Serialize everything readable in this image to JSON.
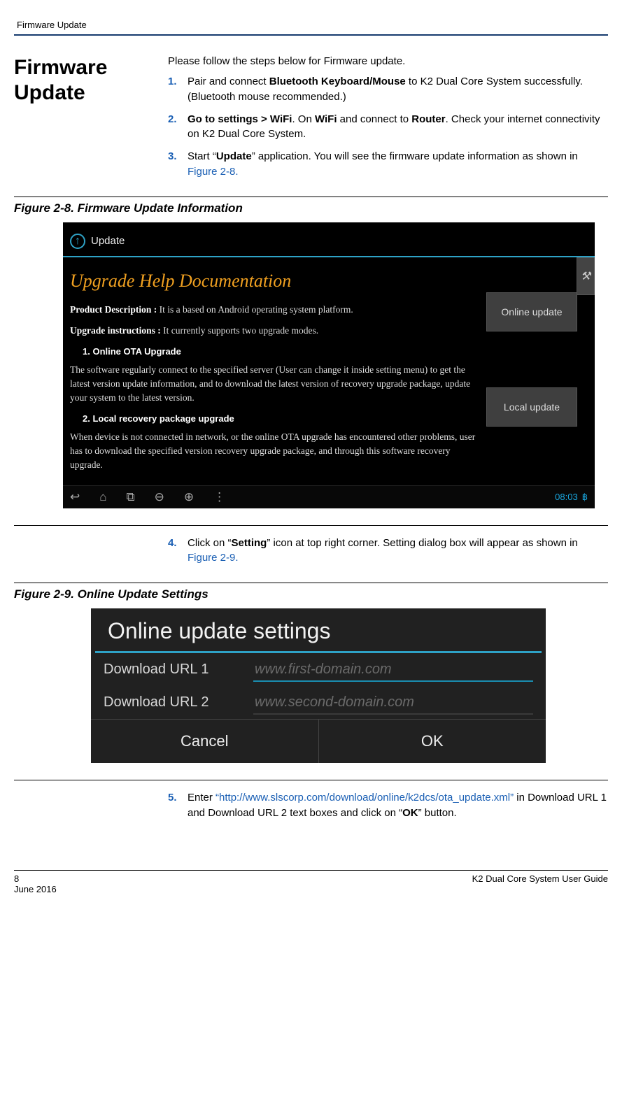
{
  "header": {
    "breadcrumb": "Firmware Update"
  },
  "section": {
    "title_line1": "Firmware",
    "title_line2": "Update"
  },
  "intro": "Please follow the steps below for Firmware update.",
  "steps": {
    "s1": {
      "num": "1.",
      "a": "Pair and connect ",
      "b": "Bluetooth Keyboard/Mouse",
      "c": " to K2 Dual Core System successfully. (Bluetooth mouse recommended.)"
    },
    "s2": {
      "num": "2.",
      "a": "Go to settings > WiFi",
      "b": ". On ",
      "c": "WiFi",
      "d": " and connect to ",
      "e": "Router",
      "f": ". Check your internet connectivity on K2 Dual Core System."
    },
    "s3": {
      "num": "3.",
      "a": "Start “",
      "b": "Update",
      "c": "” application. You will see the firmware update information as shown in ",
      "d": "Figure 2-8."
    },
    "s4": {
      "num": "4.",
      "a": "Click on “",
      "b": "Setting",
      "c": "” icon at top right corner. Setting dialog box will appear as shown in ",
      "d": "Figure 2-9."
    },
    "s5": {
      "num": "5.",
      "a": "Enter ",
      "b": "“http://www.slscorp.com/download/online/k2dcs/ota_update.xml”",
      "c": " in Download URL 1 and Download URL 2 text boxes and click on “",
      "d": "OK",
      "e": "” button."
    }
  },
  "fig28": {
    "caption": "Figure 2-8. Firmware Update Information",
    "arrow": "↑",
    "appname": "Update",
    "heading": "Upgrade Help Documentation",
    "pd_lbl": "Product Description :",
    "pd_txt": " It is a based on Android operating system platform.",
    "ui_lbl": "Upgrade instructions :",
    "ui_txt": " It currently supports two upgrade modes.",
    "mode1_title": "1. Online OTA Upgrade",
    "mode1_desc": "The software regularly connect to the specified server (User can change it inside setting menu) to get the latest version update information, and to download the latest version of recovery upgrade package, update your system to the latest version.",
    "mode2_title": "2. Local recovery package upgrade",
    "mode2_desc": "When device is not connected in network, or the online OTA upgrade has encountered other problems, user has to download the specified version recovery upgrade package, and through this software recovery upgrade.",
    "btn_online": "Online update",
    "btn_local": "Local update",
    "setting_glyph": "⚒",
    "nav": {
      "back": "↩",
      "home": "⌂",
      "recent": "⧉",
      "vol_down": "⊖",
      "vol_up": "⊕",
      "menu": "⋮"
    },
    "clock": "08:03",
    "bt": "฿"
  },
  "fig29": {
    "caption": "Figure 2-9. Online Update Settings",
    "title": "Online update settings",
    "label1": "Download URL 1",
    "value1": "www.first-domain.com",
    "label2": "Download URL 2",
    "value2": "www.second-domain.com",
    "cancel": "Cancel",
    "ok": "OK"
  },
  "footer": {
    "page": "8",
    "date": "June 2016",
    "guide": "K2 Dual Core System User Guide"
  }
}
